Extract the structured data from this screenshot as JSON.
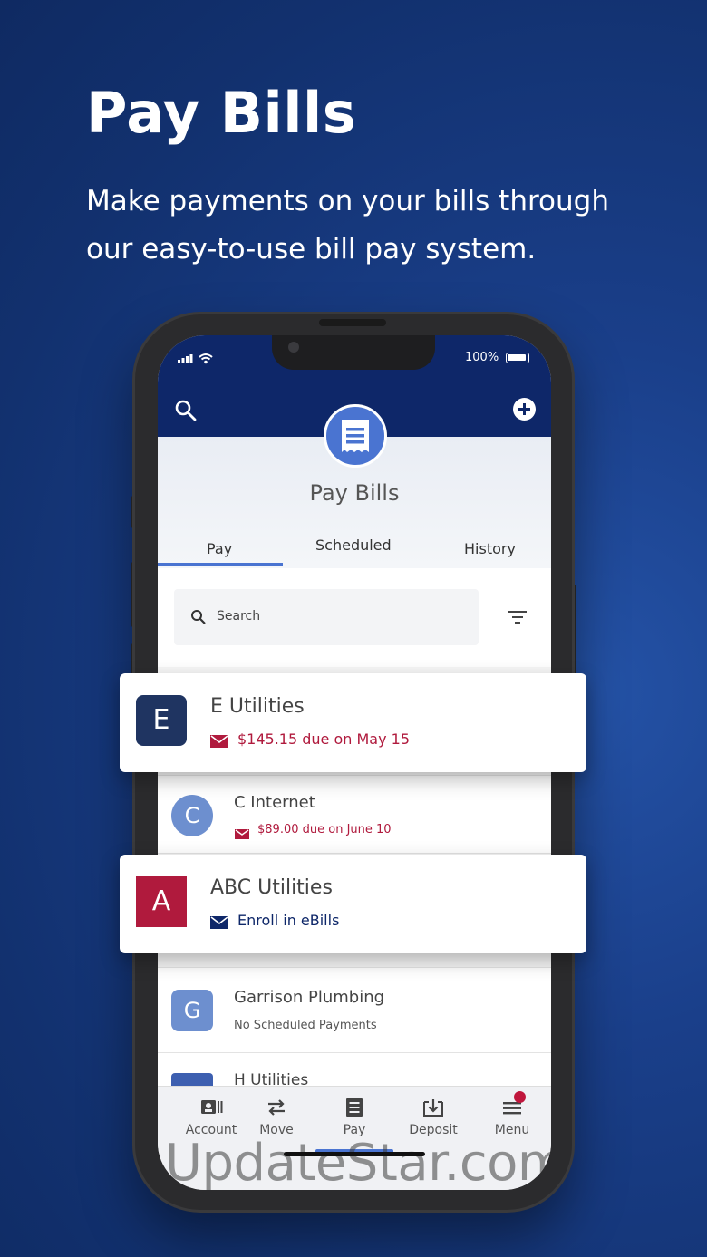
{
  "promo": {
    "headline": "Pay Bills",
    "subline": "Make payments on your bills through our easy-to-use bill pay system."
  },
  "status_bar": {
    "battery": "100%"
  },
  "app": {
    "title": "Pay Bills",
    "tabs": [
      "Pay",
      "Scheduled",
      "History"
    ],
    "active_tab": "Pay",
    "search_placeholder": "Search"
  },
  "payees": [
    {
      "initial": "E",
      "name": "E Utilities",
      "status": "$145.15 due on May 15",
      "color": "#1f3461"
    },
    {
      "initial": "C",
      "name": "C Internet",
      "status": "$89.00 due on June 10",
      "color": "#6d8fcf"
    },
    {
      "initial": "A",
      "name": "ABC Utilities",
      "status": "Enroll in eBills",
      "color": "#b01a3d"
    },
    {
      "initial": "G",
      "name": "Garrison Plumbing",
      "status": "No Scheduled Payments",
      "color": "#6d8fcf"
    },
    {
      "initial": "H",
      "name": "H Utilities",
      "status": "",
      "color": "#3d5fb0"
    }
  ],
  "bottom_nav": [
    {
      "label": "Account",
      "icon": "account-icon"
    },
    {
      "label": "Move",
      "icon": "transfer-icon"
    },
    {
      "label": "Pay",
      "icon": "bill-icon"
    },
    {
      "label": "Deposit",
      "icon": "deposit-icon"
    },
    {
      "label": "Menu",
      "icon": "menu-icon"
    }
  ],
  "watermark": "UpdateStar.com",
  "colors": {
    "navy": "#0e2769",
    "accent": "#4a74d1",
    "due_red": "#b01a3d"
  }
}
